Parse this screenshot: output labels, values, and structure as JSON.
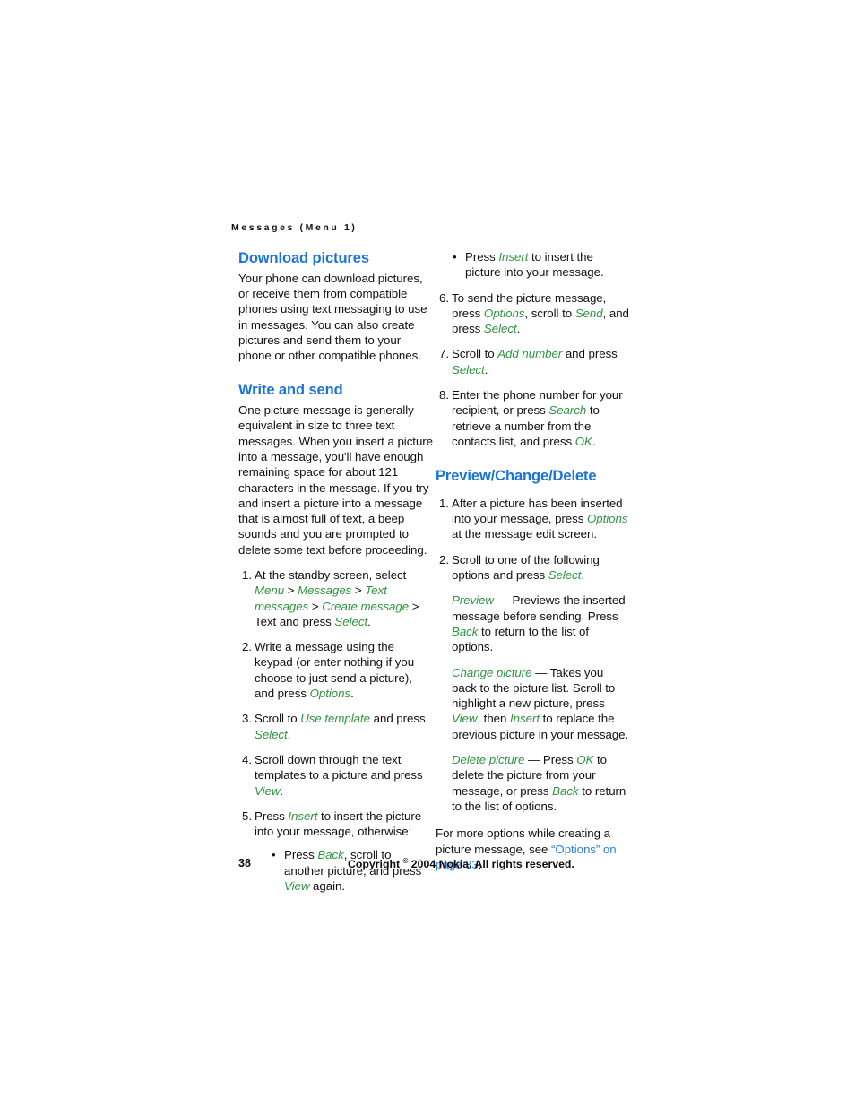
{
  "running_head": "Messages (Menu 1)",
  "colors": {
    "heading_blue": "#1a74d8",
    "ui_term_green": "#2f9440",
    "crossref_blue": "#2f7fe0",
    "body_black": "#101010",
    "page_background": "#ffffff"
  },
  "left_column": {
    "download_pictures": {
      "heading": "Download pictures",
      "paragraph": "Your phone can download pictures, or receive them from compatible phones using text messaging to use in messages. You can also create pictures and send them to your phone or other compatible phones."
    },
    "write_and_send": {
      "heading": "Write and send",
      "paragraph": "One picture message is generally equivalent in size to three text messages. When you insert a picture into a message, you'll have enough remaining space for about 121 characters in the message. If you try and insert a picture into a message that is almost full of text, a beep sounds and you are prompted to delete some text before proceeding.",
      "steps": [
        {
          "number": "1.",
          "parts": [
            {
              "text": "At the standby screen, select ",
              "style": "plain"
            },
            {
              "text": "Menu",
              "style": "ui"
            },
            {
              "text": " > ",
              "style": "plain"
            },
            {
              "text": "Messages",
              "style": "ui"
            },
            {
              "text": " > ",
              "style": "plain"
            },
            {
              "text": "Text messages",
              "style": "ui"
            },
            {
              "text": " > ",
              "style": "plain"
            },
            {
              "text": "Create message",
              "style": "ui"
            },
            {
              "text": " > Text and press ",
              "style": "plain"
            },
            {
              "text": "Select",
              "style": "ui"
            },
            {
              "text": ".",
              "style": "plain"
            }
          ]
        },
        {
          "number": "2.",
          "parts": [
            {
              "text": "Write a message using the keypad (or enter nothing if you choose to just send a picture), and press ",
              "style": "plain"
            },
            {
              "text": "Options",
              "style": "ui"
            },
            {
              "text": ".",
              "style": "plain"
            }
          ]
        },
        {
          "number": "3.",
          "parts": [
            {
              "text": "Scroll to ",
              "style": "plain"
            },
            {
              "text": "Use template",
              "style": "ui"
            },
            {
              "text": " and press ",
              "style": "plain"
            },
            {
              "text": "Select",
              "style": "ui"
            },
            {
              "text": ".",
              "style": "plain"
            }
          ]
        },
        {
          "number": "4.",
          "parts": [
            {
              "text": "Scroll down through the text templates to a picture and press ",
              "style": "plain"
            },
            {
              "text": "View",
              "style": "ui"
            },
            {
              "text": ".",
              "style": "plain"
            }
          ]
        },
        {
          "number": "5.",
          "parts": [
            {
              "text": "Press ",
              "style": "plain"
            },
            {
              "text": "Insert",
              "style": "ui"
            },
            {
              "text": " to insert the picture into your message, otherwise:",
              "style": "plain"
            }
          ],
          "sub_bullets": [
            {
              "marker": "•",
              "parts": [
                {
                  "text": "Press ",
                  "style": "plain"
                },
                {
                  "text": "Back",
                  "style": "ui"
                },
                {
                  "text": ", scroll to another picture, and press ",
                  "style": "plain"
                },
                {
                  "text": "View",
                  "style": "ui"
                },
                {
                  "text": " again.",
                  "style": "plain"
                }
              ]
            }
          ]
        }
      ]
    }
  },
  "right_column": {
    "continued_bullet": {
      "marker": "•",
      "parts": [
        {
          "text": "Press ",
          "style": "plain"
        },
        {
          "text": "Insert",
          "style": "ui"
        },
        {
          "text": " to insert the picture into your message.",
          "style": "plain"
        }
      ]
    },
    "continued_steps": [
      {
        "number": "6.",
        "parts": [
          {
            "text": "To send the picture message, press ",
            "style": "plain"
          },
          {
            "text": "Options",
            "style": "ui"
          },
          {
            "text": ", scroll to ",
            "style": "plain"
          },
          {
            "text": "Send",
            "style": "ui"
          },
          {
            "text": ", and press ",
            "style": "plain"
          },
          {
            "text": "Select",
            "style": "ui"
          },
          {
            "text": ".",
            "style": "plain"
          }
        ]
      },
      {
        "number": "7.",
        "parts": [
          {
            "text": "Scroll to ",
            "style": "plain"
          },
          {
            "text": "Add number",
            "style": "ui"
          },
          {
            "text": " and press ",
            "style": "plain"
          },
          {
            "text": "Select",
            "style": "ui"
          },
          {
            "text": ".",
            "style": "plain"
          }
        ]
      },
      {
        "number": "8.",
        "parts": [
          {
            "text": "Enter the phone number for your recipient, or press ",
            "style": "plain"
          },
          {
            "text": "Search",
            "style": "ui"
          },
          {
            "text": " to retrieve a number from the contacts list, and press ",
            "style": "plain"
          },
          {
            "text": "OK",
            "style": "ui"
          },
          {
            "text": ".",
            "style": "plain"
          }
        ]
      }
    ],
    "preview_change_delete": {
      "heading": "Preview/Change/Delete",
      "steps": [
        {
          "number": "1.",
          "parts": [
            {
              "text": "After a picture has been inserted into your message, press ",
              "style": "plain"
            },
            {
              "text": "Options",
              "style": "ui"
            },
            {
              "text": " at the message edit screen.",
              "style": "plain"
            }
          ]
        },
        {
          "number": "2.",
          "parts": [
            {
              "text": "Scroll to one of the following options and press ",
              "style": "plain"
            },
            {
              "text": "Select",
              "style": "ui"
            },
            {
              "text": ".",
              "style": "plain"
            }
          ]
        }
      ],
      "option_definitions": [
        {
          "parts": [
            {
              "text": "Preview",
              "style": "ui"
            },
            {
              "text": " — Previews the inserted message before sending. Press ",
              "style": "plain"
            },
            {
              "text": "Back",
              "style": "ui"
            },
            {
              "text": " to return to the list of options.",
              "style": "plain"
            }
          ]
        },
        {
          "parts": [
            {
              "text": "Change picture",
              "style": "ui"
            },
            {
              "text": " — Takes you back to the picture list. Scroll to highlight a new picture, press ",
              "style": "plain"
            },
            {
              "text": "View",
              "style": "ui"
            },
            {
              "text": ", then ",
              "style": "plain"
            },
            {
              "text": "Insert",
              "style": "ui"
            },
            {
              "text": " to replace the previous picture in your message.",
              "style": "plain"
            }
          ]
        },
        {
          "parts": [
            {
              "text": "Delete picture",
              "style": "ui"
            },
            {
              "text": " — Press ",
              "style": "plain"
            },
            {
              "text": "OK",
              "style": "ui"
            },
            {
              "text": " to delete the picture from your message, or press ",
              "style": "plain"
            },
            {
              "text": "Back",
              "style": "ui"
            },
            {
              "text": " to return to the list of options.",
              "style": "plain"
            }
          ]
        }
      ],
      "trailing_note": {
        "parts": [
          {
            "text": "For more options while creating a picture message, see ",
            "style": "plain"
          },
          {
            "text": "“Options” on page 33",
            "style": "xref"
          },
          {
            "text": ".",
            "style": "plain"
          }
        ]
      }
    }
  },
  "footer": {
    "page_number": "38",
    "copyright_prefix": "Copyright ",
    "copyright_symbol": "©",
    "copyright_suffix": " 2004 Nokia. All rights reserved."
  }
}
